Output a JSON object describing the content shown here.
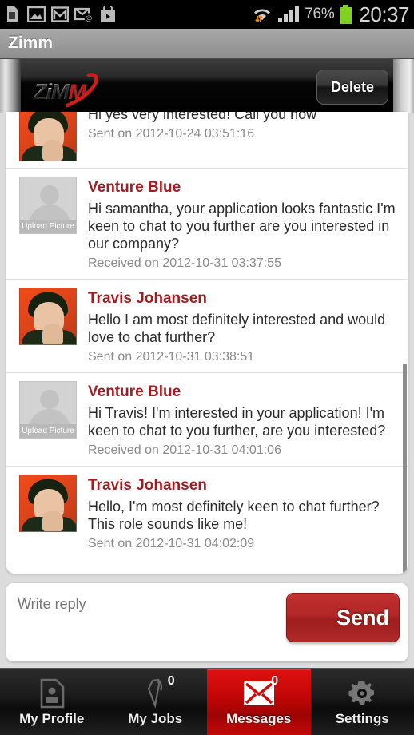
{
  "statusbar": {
    "icons": [
      "sd-card-icon",
      "gallery-icon",
      "gmail-icon",
      "email-at-icon",
      "play-store-icon"
    ],
    "wifi_icon": "wifi-transfer-icon",
    "signal_icon": "signal-bars-icon",
    "battery_percent": "76%",
    "battery_icon": "battery-icon",
    "clock": "20:37"
  },
  "titlebar": {
    "title": "Zimm"
  },
  "appheader": {
    "logo_text_light": "ZiM",
    "logo_text_accent": "M",
    "logo_name": "zimm-logo",
    "delete_label": "Delete"
  },
  "messages": [
    {
      "avatar": "photo",
      "avatar_label": "",
      "sender": "",
      "text": "Hi yes very interested! Call you now",
      "stamp": "Sent on 2012-10-24 03:51:16",
      "clipped": true
    },
    {
      "avatar": "placeholder",
      "avatar_label": "Upload Picture",
      "sender": "Venture Blue",
      "text": "Hi samantha, your application looks fantastic I'm keen to chat to you further are you interested in our company?",
      "stamp": "Received on 2012-10-31 03:37:55",
      "clipped": false
    },
    {
      "avatar": "photo",
      "avatar_label": "",
      "sender": "Travis Johansen",
      "text": "Hello I am most definitely interested and would love to chat further?",
      "stamp": "Sent on 2012-10-31 03:38:51",
      "clipped": false
    },
    {
      "avatar": "placeholder",
      "avatar_label": "Upload Picture",
      "sender": "Venture Blue",
      "text": "Hi Travis! I'm interested in your application! I'm keen to chat to you further, are you interested?",
      "stamp": "Received on 2012-10-31 04:01:06",
      "clipped": false
    },
    {
      "avatar": "photo",
      "avatar_label": "",
      "sender": "Travis Johansen",
      "text": "Hello, I'm most definitely keen to chat further? This role sounds like me!",
      "stamp": "Sent on 2012-10-31 04:02:09",
      "clipped": false
    }
  ],
  "reply": {
    "placeholder": "Write reply",
    "value": "",
    "send_label": "Send"
  },
  "bottomnav": {
    "items": [
      {
        "label": "My Profile",
        "icon": "profile-card-icon",
        "badge": "",
        "active": false
      },
      {
        "label": "My Jobs",
        "icon": "tie-icon",
        "badge": "0",
        "active": false
      },
      {
        "label": "Messages",
        "icon": "envelope-icon",
        "badge": "0",
        "active": true
      },
      {
        "label": "Settings",
        "icon": "gear-icon",
        "badge": "",
        "active": false
      }
    ]
  },
  "colors": {
    "accent_red": "#c40606",
    "sender_red": "#a11d21",
    "send_button": "#b22727"
  }
}
